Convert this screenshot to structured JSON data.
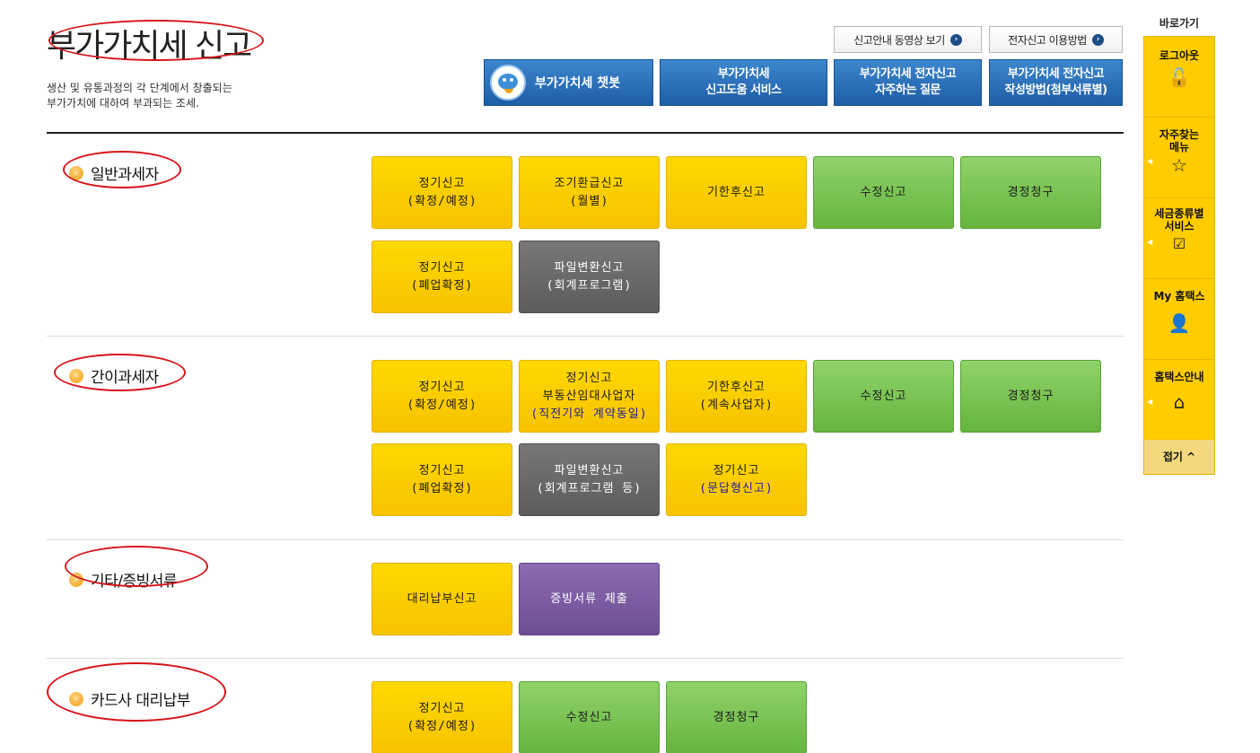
{
  "header": {
    "title": "부가가치세 신고",
    "desc_line1": "생산 및 유통과정의 각 단계에서 창출되는",
    "desc_line2": "부가가치에 대하여 부과되는 조세."
  },
  "top_links": {
    "video": "신고안내 동영상 보기",
    "howto": "전자신고 이용방법"
  },
  "top_buttons": {
    "chatbot": "부가가치세 챗봇",
    "help_l1": "부가가치세",
    "help_l2": "신고도움 서비스",
    "faq_l1": "부가가치세 전자신고",
    "faq_l2": "자주하는 질문",
    "guide_l1": "부가가치세 전자신고",
    "guide_l2": "작성방법(첨부서류별)"
  },
  "sections": {
    "general": {
      "label": "일반과세자",
      "regular_l1": "정기신고",
      "regular_l2": "(확정/예정)",
      "early_l1": "조기환급신고",
      "early_l2": "(월별)",
      "late": "기한후신고",
      "amend": "수정신고",
      "claim": "경정청구",
      "closure_l1": "정기신고",
      "closure_l2": "(폐업확정)",
      "file_l1": "파일변환신고",
      "file_l2": "(회계프로그램)"
    },
    "simplified": {
      "label": "간이과세자",
      "regular_l1": "정기신고",
      "regular_l2": "(확정/예정)",
      "realty_l1": "정기신고",
      "realty_l2": "부동산임대사업자",
      "realty_l3": "(직전기와 계약동일)",
      "late_l1": "기한후신고",
      "late_l2": "(계속사업자)",
      "amend": "수정신고",
      "claim": "경정청구",
      "closure_l1": "정기신고",
      "closure_l2": "(폐업확정)",
      "file_l1": "파일변환신고",
      "file_l2": "(회계프로그램 등)",
      "qa_l1": "정기신고",
      "qa_l2": "(문답형신고)"
    },
    "other": {
      "label": "기타/증빙서류",
      "proxy": "대리납부신고",
      "evidence": "증빙서류 제출"
    },
    "card": {
      "label": "카드사 대리납부",
      "regular_l1": "정기신고",
      "regular_l2": "(확정/예정)",
      "amend": "수정신고",
      "claim": "경정청구"
    }
  },
  "quickbar": {
    "title": "바로가기",
    "logout": "로그아웃",
    "faq_menu_l1": "자주찾는",
    "faq_menu_l2": "메뉴",
    "tax_service_l1": "세금종류별",
    "tax_service_l2": "서비스",
    "myhometax": "My 홈택스",
    "hometax_guide": "홈택스안내",
    "fold": "접기 ^"
  },
  "colors": {
    "accent_yellow": "#ffd800",
    "accent_green": "#7cc655",
    "accent_gray": "#666666",
    "accent_purple": "#7b5ca3",
    "accent_blue": "#2a6fba",
    "annotation_red": "#d7141a"
  }
}
